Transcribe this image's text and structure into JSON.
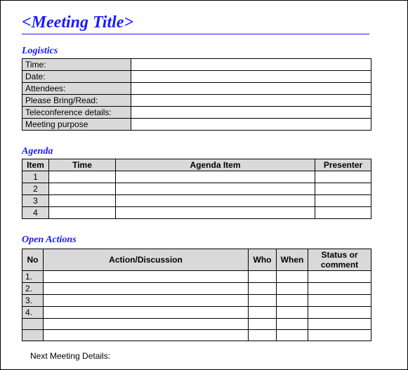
{
  "title": "<Meeting Title>",
  "logistics": {
    "heading": "Logistics",
    "rows": [
      {
        "label": "Time:",
        "value": ""
      },
      {
        "label": "Date:",
        "value": ""
      },
      {
        "label": "Attendees:",
        "value": ""
      },
      {
        "label": "Please Bring/Read:",
        "value": ""
      },
      {
        "label": "Teleconference details:",
        "value": ""
      },
      {
        "label": "Meeting purpose",
        "value": ""
      }
    ]
  },
  "agenda": {
    "heading": "Agenda",
    "columns": {
      "item": "Item",
      "time": "Time",
      "topic": "Agenda Item",
      "presenter": "Presenter"
    },
    "rows": [
      {
        "item": "1",
        "time": "",
        "topic": "",
        "presenter": ""
      },
      {
        "item": "2",
        "time": "",
        "topic": "",
        "presenter": ""
      },
      {
        "item": "3",
        "time": "",
        "topic": "",
        "presenter": ""
      },
      {
        "item": "4",
        "time": "",
        "topic": "",
        "presenter": ""
      }
    ]
  },
  "actions": {
    "heading": "Open Actions",
    "columns": {
      "no": "No",
      "action": "Action/Discussion",
      "who": "Who",
      "when": "When",
      "status": "Status or comment"
    },
    "rows": [
      {
        "no": "1.",
        "action": "",
        "who": "",
        "when": "",
        "status": ""
      },
      {
        "no": "2.",
        "action": "",
        "who": "",
        "when": "",
        "status": ""
      },
      {
        "no": "3.",
        "action": "",
        "who": "",
        "when": "",
        "status": ""
      },
      {
        "no": "4.",
        "action": "",
        "who": "",
        "when": "",
        "status": ""
      },
      {
        "no": "",
        "action": "",
        "who": "",
        "when": "",
        "status": ""
      },
      {
        "no": "",
        "action": "",
        "who": "",
        "when": "",
        "status": ""
      }
    ]
  },
  "footer": {
    "next_meeting": "Next Meeting Details:"
  }
}
